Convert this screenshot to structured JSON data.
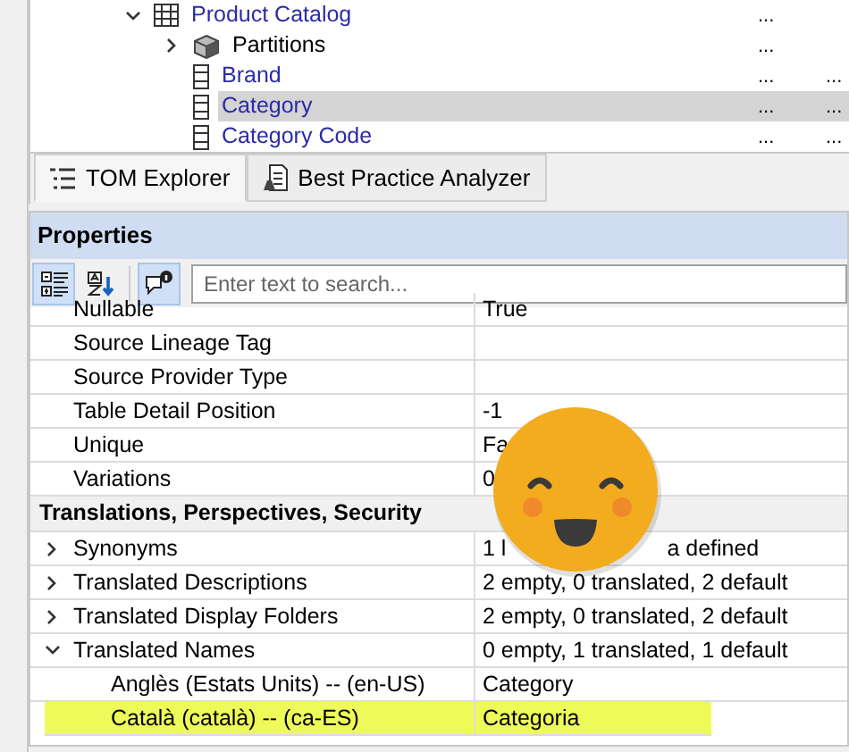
{
  "tree": [
    {
      "label": "Product Catalog",
      "kind": "table",
      "expanded": true,
      "selected": false,
      "cells": [
        "..."
      ],
      "children": [
        {
          "label": "Partitions",
          "kind": "partitions",
          "expanded": false,
          "selected": false,
          "cells": [
            "..."
          ]
        },
        {
          "label": "Brand",
          "kind": "column",
          "selected": false,
          "cells": [
            "...",
            "..."
          ]
        },
        {
          "label": "Category",
          "kind": "column",
          "selected": true,
          "cells": [
            "...",
            "..."
          ]
        },
        {
          "label": "Category Code",
          "kind": "column",
          "selected": false,
          "cells": [
            "...",
            "..."
          ]
        }
      ]
    }
  ],
  "tabs": [
    {
      "label": "TOM Explorer",
      "kind": "explorer",
      "selected": true
    },
    {
      "label": "Best Practice Analyzer",
      "kind": "analyzer",
      "selected": false
    }
  ],
  "properties": {
    "title": "Properties",
    "toolbar": [
      {
        "kind": "categorized",
        "on": true
      },
      {
        "kind": "alphabetical",
        "on": false
      },
      {
        "kind": "description",
        "on": true
      }
    ],
    "search": {
      "placeholder": "Enter text to search..."
    },
    "rows": [
      {
        "kind": "property",
        "name": "Nullable",
        "value": "True"
      },
      {
        "kind": "property",
        "name": "Source Lineage Tag"
      },
      {
        "kind": "property",
        "name": "Source Provider Type"
      },
      {
        "kind": "property",
        "name": "Table Detail Position",
        "value": "-1"
      },
      {
        "kind": "property",
        "name": "Unique",
        "value": "Fa"
      },
      {
        "kind": "property",
        "name": "Variations",
        "value": "0"
      },
      {
        "kind": "category",
        "name": "Translations, Perspectives, Security"
      },
      {
        "kind": "property",
        "name": "Synonyms",
        "value_parts": [
          "1 l",
          "a defined"
        ],
        "expanded": false
      },
      {
        "kind": "property",
        "name": "Translated Descriptions",
        "value": "2 empty, 0 translated, 2 default",
        "expanded": false
      },
      {
        "kind": "property",
        "name": "Translated Display Folders",
        "value": "2 empty, 0 translated, 2 default",
        "expanded": false
      },
      {
        "kind": "property",
        "name": "Translated Names",
        "value": "0 empty, 1 translated, 1 default",
        "expanded": true,
        "children": [
          {
            "kind": "property",
            "name": "Anglès (Estats Units) -- (en-US)",
            "value": "Category",
            "highlighted": false
          },
          {
            "kind": "property",
            "name": "Català (català) -- (ca-ES)",
            "value": "Categoria",
            "highlighted": true
          }
        ]
      }
    ]
  },
  "overlay": {
    "kind": "smiley"
  }
}
